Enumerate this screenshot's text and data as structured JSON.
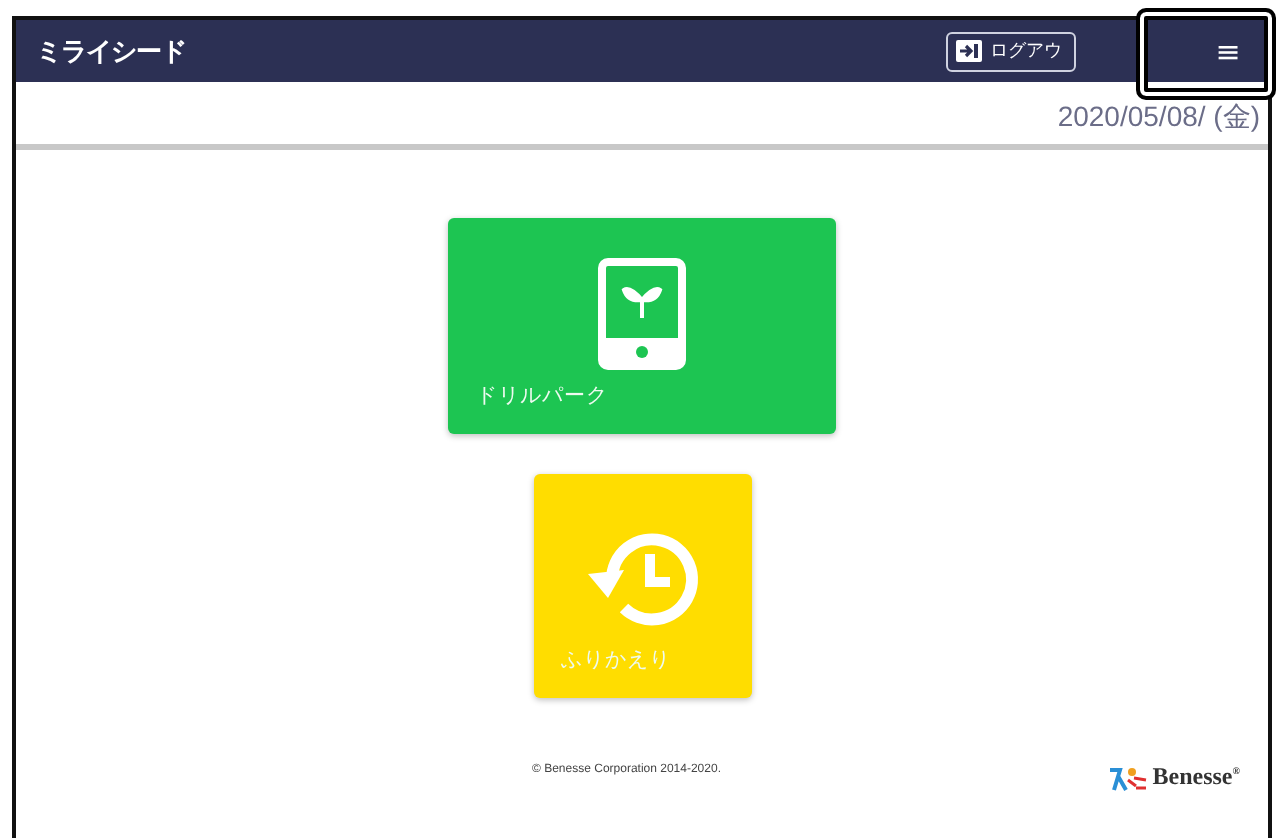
{
  "header": {
    "logo": "ミライシード",
    "logout_button": "ログアウ",
    "menu_button": "≡"
  },
  "date": "2020/05/08/ (金)",
  "tiles": [
    {
      "kind": "tablet",
      "label": "ドリルパーク",
      "color": "#1dc552"
    },
    {
      "kind": "history",
      "label": "ふりかえり",
      "color": "#ffdd00"
    }
  ],
  "footer": {
    "copyright": "© Benesse Corporation 2014-2020.",
    "brand": "Benesse$^{®}$"
  }
}
